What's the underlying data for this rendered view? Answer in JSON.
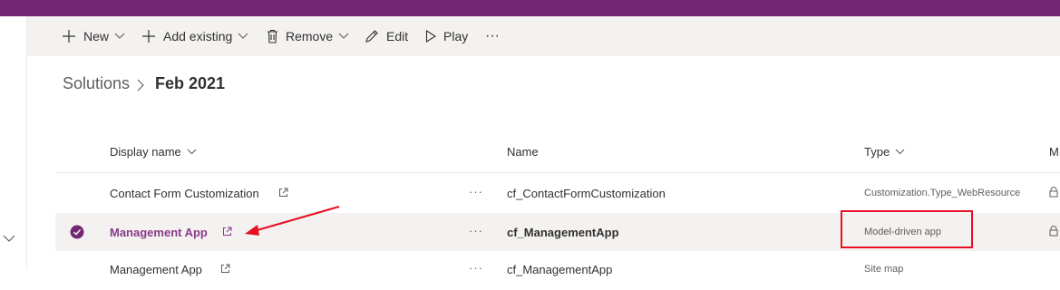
{
  "commands": {
    "new_label": "New",
    "add_existing_label": "Add existing",
    "remove_label": "Remove",
    "edit_label": "Edit",
    "play_label": "Play",
    "more_label": "···"
  },
  "breadcrumb": {
    "root": "Solutions",
    "current": "Feb 2021"
  },
  "table": {
    "columns": {
      "display_name": "Display name",
      "name": "Name",
      "type": "Type",
      "partial": "M"
    },
    "rows": [
      {
        "display_name": "Contact Form Customization",
        "name": "cf_ContactFormCustomization",
        "type": "Customization.Type_WebResource"
      },
      {
        "display_name": "Management App",
        "name": "cf_ManagementApp",
        "type": "Model-driven app"
      },
      {
        "display_name": "Management App",
        "name": "cf_ManagementApp",
        "type": "Site map"
      }
    ],
    "more_label": "···"
  },
  "colors": {
    "brand": "#742774",
    "selected_link": "#8a3a8a",
    "annotation": "#e81123"
  }
}
